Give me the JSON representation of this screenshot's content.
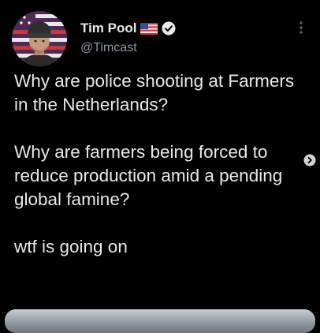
{
  "author": {
    "display_name": "Tim Pool",
    "handle": "@Timcast",
    "flag_icon": "us-flag-icon",
    "verified_icon": "verified-badge-icon"
  },
  "tweet": {
    "paragraphs": [
      "Why are police shooting at Farmers in the Netherlands?",
      "Why are farmers being forced to reduce production amid a pending global famine?",
      "wtf is going on"
    ]
  },
  "icons": {
    "more": "more-vertical-icon",
    "scroll": "chevron-right-circle-icon"
  },
  "colors": {
    "background": "#000000",
    "text": "#e7e9ea",
    "secondary_text": "#8b98a5"
  }
}
